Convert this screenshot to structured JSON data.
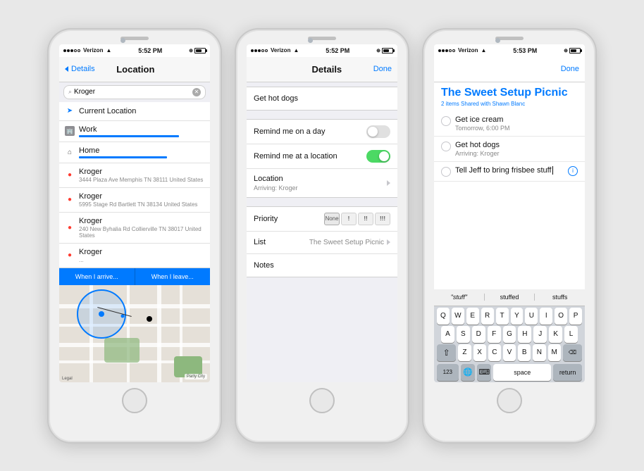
{
  "phones": [
    {
      "id": "phone1",
      "statusBar": {
        "carrier": "Verizon",
        "time": "5:52 PM",
        "icons": "⊕ ■ ■ ■"
      },
      "navBar": {
        "back": "Details",
        "title": "Location",
        "action": null
      },
      "search": {
        "placeholder": "Kroger",
        "value": "Kroger"
      },
      "locationItems": [
        {
          "type": "current",
          "name": "Current Location",
          "addr": ""
        },
        {
          "type": "work",
          "name": "Work",
          "addr": "",
          "hasBar": true
        },
        {
          "type": "home",
          "name": "Home",
          "addr": "",
          "hasBar": true
        },
        {
          "type": "red",
          "name": "Kroger",
          "addr": "3444 Plaza Ave Memphis TN 38111 United States"
        },
        {
          "type": "red",
          "name": "Kroger",
          "addr": "5995 Stage Rd Bartlett TN 38134 United States"
        },
        {
          "type": "red",
          "name": "Kroger",
          "addr": "240 New Byhalia Rd Collierville TN 38017 United States"
        },
        {
          "type": "red",
          "name": "Kroger",
          "addr": "..."
        }
      ],
      "arriveLabel": "When I arrive...",
      "leaveLabel": "When I leave..."
    },
    {
      "id": "phone2",
      "statusBar": {
        "carrier": "Verizon",
        "time": "5:52 PM"
      },
      "navBar": {
        "back": null,
        "title": "Details",
        "action": "Done"
      },
      "rows": [
        {
          "label": "Get hot dogs",
          "type": "taskname"
        },
        {
          "label": "Remind me on a day",
          "type": "toggle",
          "value": "off"
        },
        {
          "label": "Remind me at a location",
          "type": "toggle",
          "value": "on"
        },
        {
          "label": "Location",
          "sublabel": "Arriving: Kroger",
          "type": "chevron"
        },
        {
          "label": "Priority",
          "type": "priority",
          "options": [
            "None",
            "!",
            "!!",
            "!!!"
          ]
        },
        {
          "label": "List",
          "sublabel": "The Sweet Setup Picnic",
          "type": "chevron"
        },
        {
          "label": "Notes",
          "type": "notes"
        }
      ]
    },
    {
      "id": "phone3",
      "statusBar": {
        "carrier": "Verizon",
        "time": "5:53 PM"
      },
      "navBar": {
        "back": null,
        "title": null,
        "action": "Done"
      },
      "listTitle": "The Sweet Setup Picnic",
      "listSubtitle": "2 items  Shared with Shawn Blanc",
      "todos": [
        {
          "name": "Get ice cream",
          "sub": "Tomorrow, 6:00 PM",
          "hasInfo": false
        },
        {
          "name": "Get hot dogs",
          "sub": "Arriving: Kroger",
          "hasInfo": false
        },
        {
          "name": "Tell Jeff to bring frisbee stuff",
          "sub": "",
          "hasInfo": true
        }
      ],
      "suggestions": [
        "\"stuff\"",
        "stuffed",
        "stuffs"
      ],
      "keyRows": [
        [
          "Q",
          "W",
          "E",
          "R",
          "T",
          "Y",
          "U",
          "I",
          "O",
          "P"
        ],
        [
          "A",
          "S",
          "D",
          "F",
          "G",
          "H",
          "J",
          "K",
          "L"
        ],
        [
          "⇧",
          "Z",
          "X",
          "C",
          "V",
          "B",
          "N",
          "M",
          "⌫"
        ],
        [
          "123",
          "🌐",
          "⌨",
          "space",
          "return"
        ]
      ]
    }
  ]
}
